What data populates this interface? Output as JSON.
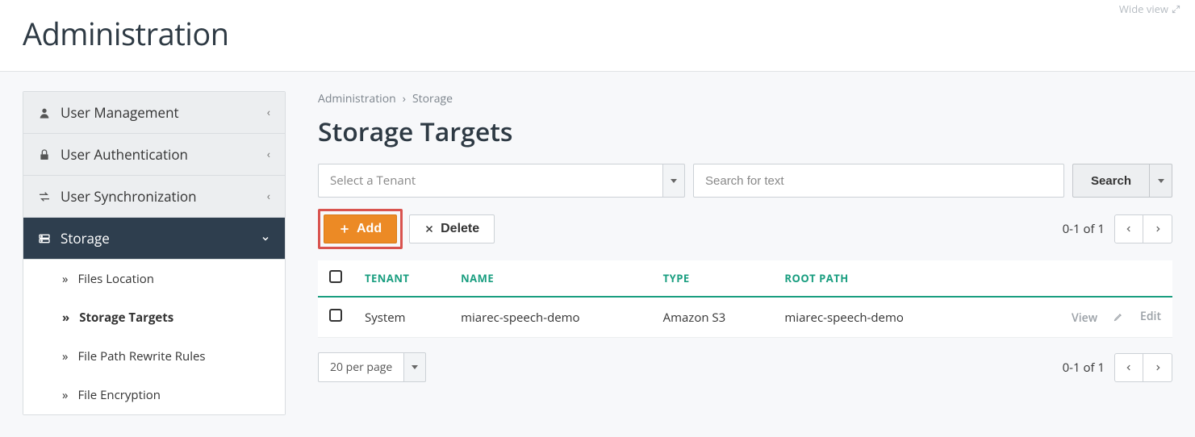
{
  "header": {
    "wide_view": "Wide view",
    "title": "Administration"
  },
  "sidebar": {
    "items": [
      {
        "label": "User Management",
        "expanded": false
      },
      {
        "label": "User Authentication",
        "expanded": false
      },
      {
        "label": "User Synchronization",
        "expanded": false
      },
      {
        "label": "Storage",
        "expanded": true
      }
    ],
    "storage_children": [
      {
        "label": "Files Location",
        "selected": false
      },
      {
        "label": "Storage Targets",
        "selected": true
      },
      {
        "label": "File Path Rewrite Rules",
        "selected": false
      },
      {
        "label": "File Encryption",
        "selected": false
      }
    ]
  },
  "breadcrumb": {
    "root": "Administration",
    "leaf": "Storage"
  },
  "section": {
    "title": "Storage Targets"
  },
  "filters": {
    "tenant_placeholder": "Select a Tenant",
    "search_placeholder": "Search for text",
    "search_button": "Search"
  },
  "actions": {
    "add": "Add",
    "delete": "Delete"
  },
  "pagination": {
    "summary": "0-1 of 1",
    "per_page": "20 per page"
  },
  "table": {
    "columns": {
      "tenant": "TENANT",
      "name": "NAME",
      "type": "TYPE",
      "root_path": "ROOT PATH"
    },
    "rows": [
      {
        "tenant": "System",
        "name": "miarec-speech-demo",
        "type": "Amazon S3",
        "root_path": "miarec-speech-demo"
      }
    ],
    "row_actions": {
      "view": "View",
      "edit": "Edit"
    }
  }
}
